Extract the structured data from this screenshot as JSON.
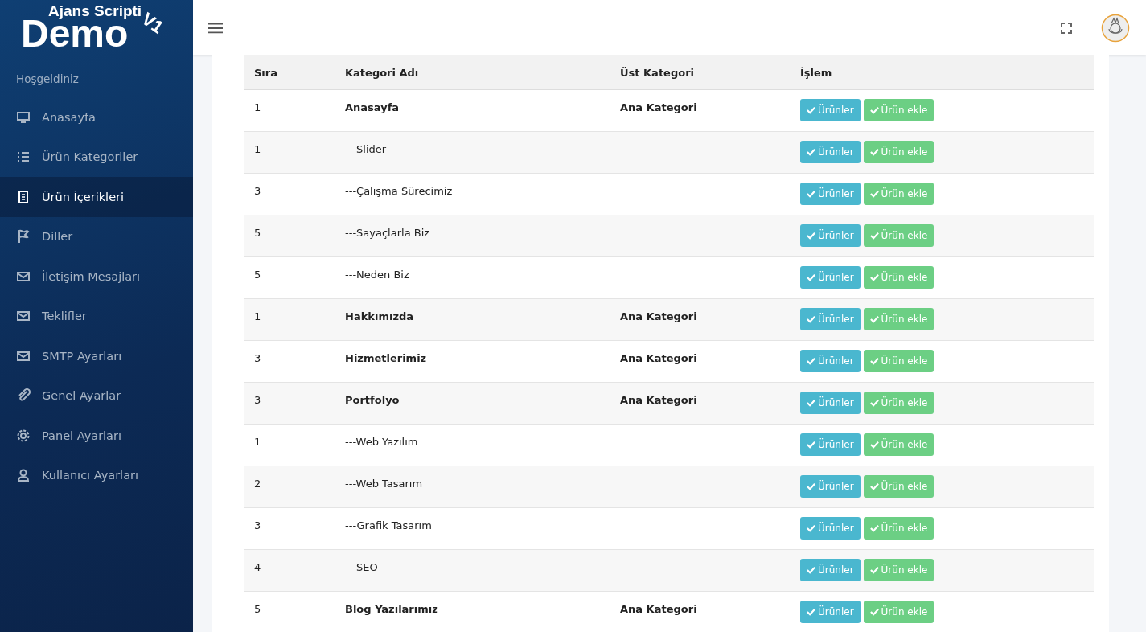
{
  "logo": {
    "top": "Ajans Scripti",
    "main": "Demo",
    "version": "V1"
  },
  "sidebar": {
    "greeting": "Hoşgeldiniz",
    "items": [
      {
        "label": "Anasayfa",
        "selected": false
      },
      {
        "label": "Ürün Kategoriler",
        "selected": false
      },
      {
        "label": "Ürün İçerikleri",
        "selected": true
      },
      {
        "label": "Diller",
        "selected": false
      },
      {
        "label": "İletişim Mesajları",
        "selected": false
      },
      {
        "label": "Teklifler",
        "selected": false
      },
      {
        "label": "SMTP Ayarları",
        "selected": false
      },
      {
        "label": "Genel Ayarlar",
        "selected": false
      },
      {
        "label": "Panel Ayarları",
        "selected": false
      },
      {
        "label": "Kullanıcı Ayarları",
        "selected": false
      }
    ]
  },
  "table": {
    "columns": [
      "Sıra",
      "Kategori Adı",
      "Üst Kategori",
      "İşlem"
    ],
    "rows": [
      {
        "kind": "main",
        "order": "1",
        "name": "Anasayfa",
        "parent": "Ana Kategori",
        "actions": [
          "Ürünler",
          "Ürün ekle"
        ]
      },
      {
        "kind": "sub",
        "order": "1",
        "name": "---Slider",
        "actions": [
          "Ürünler",
          "Ürün ekle"
        ]
      },
      {
        "kind": "sub",
        "order": "3",
        "name": "---Çalışma Sürecimiz",
        "actions": [
          "Ürünler",
          "Ürün ekle"
        ]
      },
      {
        "kind": "sub",
        "order": "5",
        "name": "---Sayaçlarla Biz",
        "actions": [
          "Ürünler",
          "Ürün ekle"
        ]
      },
      {
        "kind": "sub",
        "order": "5",
        "name": "---Neden Biz",
        "actions": [
          "Ürünler",
          "Ürün ekle"
        ]
      },
      {
        "kind": "main",
        "order": "1",
        "name": "Hakkımızda",
        "parent": "Ana Kategori",
        "actions": [
          "Ürünler",
          "Ürün ekle"
        ]
      },
      {
        "kind": "main",
        "order": "3",
        "name": "Hizmetlerimiz",
        "parent": "Ana Kategori",
        "actions": [
          "Ürünler",
          "Ürün ekle"
        ]
      },
      {
        "kind": "main",
        "order": "3",
        "name": "Portfolyo",
        "parent": "Ana Kategori",
        "actions": [
          "Ürünler",
          "Ürün ekle"
        ]
      },
      {
        "kind": "sub",
        "order": "1",
        "name": "---Web Yazılım",
        "actions": [
          "Ürünler",
          "Ürün ekle"
        ]
      },
      {
        "kind": "sub",
        "order": "2",
        "name": "---Web Tasarım",
        "actions": [
          "Ürünler",
          "Ürün ekle"
        ]
      },
      {
        "kind": "sub",
        "order": "3",
        "name": "---Grafik Tasarım",
        "actions": [
          "Ürünler",
          "Ürün ekle"
        ]
      },
      {
        "kind": "sub",
        "order": "4",
        "name": "---SEO",
        "actions": [
          "Ürünler",
          "Ürün ekle"
        ]
      },
      {
        "kind": "main",
        "order": "5",
        "name": "Blog Yazılarımız",
        "parent": "Ana Kategori",
        "actions": [
          "Ürünler",
          "Ürün ekle"
        ]
      }
    ]
  }
}
